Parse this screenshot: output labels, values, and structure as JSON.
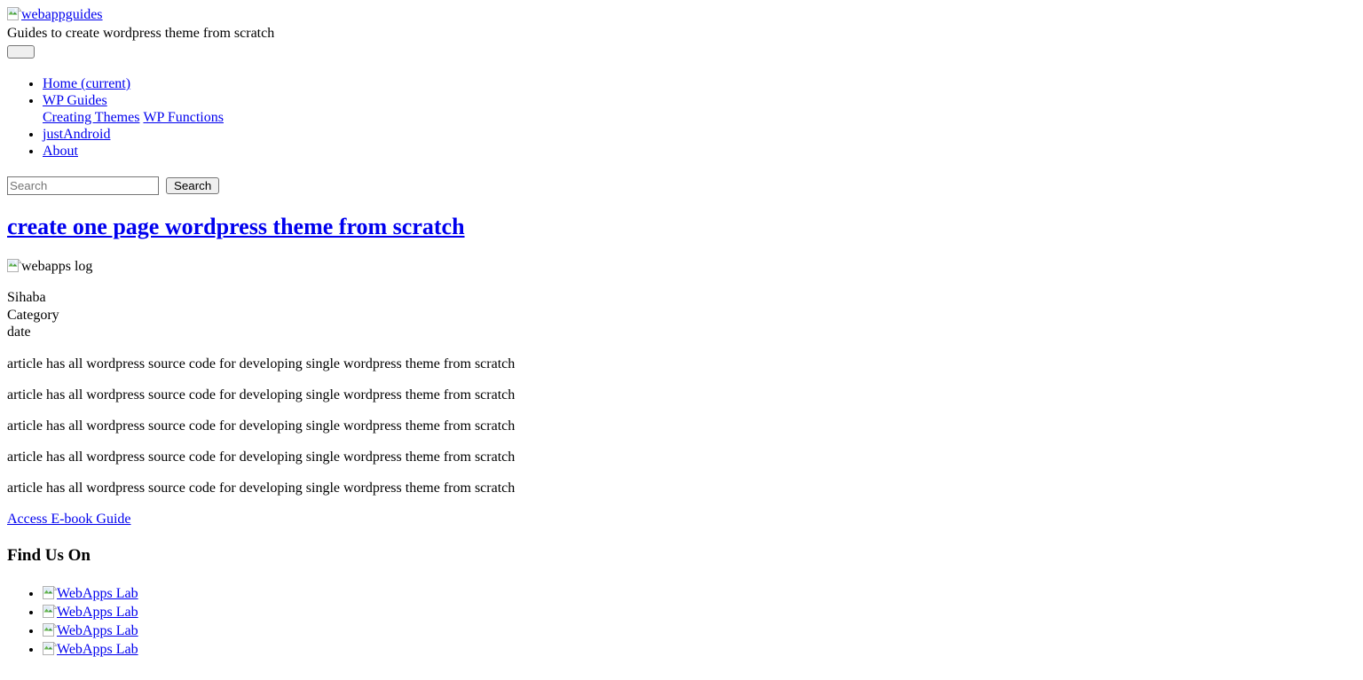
{
  "site": {
    "logo_alt": "webappguides",
    "logo_icon": "broken-image-icon",
    "tagline": "Guides to create wordpress theme from scratch",
    "toggler_label": ""
  },
  "nav": {
    "items": [
      {
        "label": "Home ",
        "suffix": "(current)",
        "has_suffix": true
      },
      {
        "label": "WP Guides",
        "has_suffix": false
      },
      {
        "label": "justAndroid",
        "has_suffix": false
      },
      {
        "label": "About",
        "has_suffix": false
      }
    ],
    "dropdown": [
      {
        "label": "Creating Themes"
      },
      {
        "label": "WP Functions"
      }
    ]
  },
  "search": {
    "placeholder": "Search",
    "value": "",
    "button_label": "Search"
  },
  "post": {
    "title": "create one page wordpress theme from scratch",
    "thumb_alt": "webapps log",
    "thumb_icon": "broken-image-icon",
    "author": "Sihaba",
    "category": "Category",
    "date": "date",
    "paragraphs": [
      "article has all wordpress source code for developing single wordpress theme from scratch",
      "article has all wordpress source code for developing single wordpress theme from scratch",
      "article has all wordpress source code for developing single wordpress theme from scratch",
      "article has all wordpress source code for developing single wordpress theme from scratch",
      "article has all wordpress source code for developing single wordpress theme from scratch"
    ],
    "ebook_link": "Access E-book Guide"
  },
  "footer": {
    "heading": "Find Us On",
    "social": [
      {
        "alt": "WebApps Lab",
        "icon": "broken-image-icon"
      },
      {
        "alt": "WebApps Lab",
        "icon": "broken-image-icon"
      },
      {
        "alt": "WebApps Lab",
        "icon": "broken-image-icon"
      },
      {
        "alt": "WebApps Lab",
        "icon": "broken-image-icon"
      }
    ]
  },
  "colors": {
    "link": "#0000EE",
    "text": "#000000",
    "background": "#ffffff",
    "placeholder": "#757575",
    "control_border": "#767676",
    "control_face": "#efefef"
  }
}
